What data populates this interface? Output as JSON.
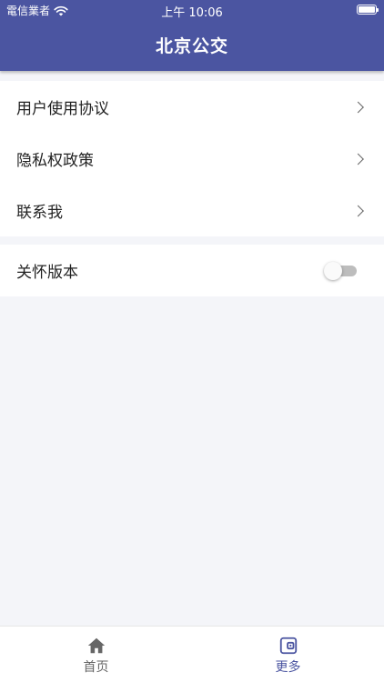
{
  "status_bar": {
    "carrier": "電信業者",
    "time": "上午 10:06"
  },
  "header": {
    "title": "北京公交"
  },
  "menu": {
    "items": [
      {
        "label": "用户使用协议",
        "icon": "chevron-right-icon"
      },
      {
        "label": "隐私权政策",
        "icon": "chevron-right-icon"
      },
      {
        "label": "联系我",
        "icon": "chevron-right-icon"
      }
    ]
  },
  "care_mode": {
    "label": "关怀版本",
    "enabled": false
  },
  "tabbar": {
    "tabs": [
      {
        "label": "首页",
        "icon": "home-icon",
        "active": false
      },
      {
        "label": "更多",
        "icon": "wallet-icon",
        "active": true
      }
    ]
  },
  "colors": {
    "primary": "#4b55a1",
    "background": "#f4f5f9",
    "text": "#222222"
  }
}
